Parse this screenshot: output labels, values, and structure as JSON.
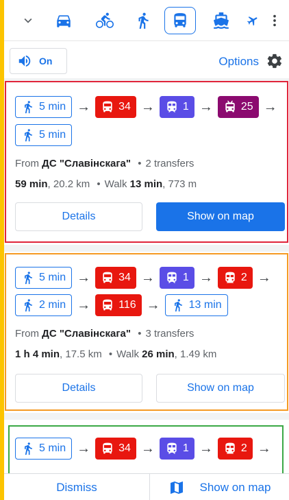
{
  "colors": {
    "frame": "#fcc400",
    "accent": "#1a73e8",
    "bus": "#e8170f",
    "metro": "#5a4de6",
    "trolleybus": "#8b0a6f",
    "tram": "#e8170f",
    "outline_1": "#e0243a",
    "outline_2": "#f59a23",
    "outline_3": "#3aa845"
  },
  "modes": [
    {
      "name": "car",
      "icon": "car-icon"
    },
    {
      "name": "bicycle",
      "icon": "bicycle-icon"
    },
    {
      "name": "walking",
      "icon": "walking-icon"
    },
    {
      "name": "transit",
      "icon": "bus-icon",
      "selected": true
    },
    {
      "name": "ferry",
      "icon": "ferry-icon"
    },
    {
      "name": "flight",
      "icon": "plane-icon"
    }
  ],
  "sound": {
    "label": "On",
    "icon": "speaker-icon"
  },
  "options_label": "Options",
  "routes": [
    {
      "steps_row1": [
        {
          "type": "walk",
          "label": "5 min"
        },
        {
          "type": "bus",
          "label": "34"
        },
        {
          "type": "metro",
          "label": "1"
        },
        {
          "type": "trolleybus",
          "label": "25"
        }
      ],
      "steps_row2": [
        {
          "type": "walk",
          "label": "5 min"
        }
      ],
      "from_prefix": "From ",
      "from_stop": "ДС \"Славінскага\"",
      "transfers": "2 transfers",
      "duration": "59 min",
      "distance": ", 20.2 km",
      "walk_prefix": "Walk ",
      "walk_time": "13 min",
      "walk_distance": ", 773 m",
      "details_label": "Details",
      "map_label": "Show on map"
    },
    {
      "steps_row1": [
        {
          "type": "walk",
          "label": "5 min"
        },
        {
          "type": "bus",
          "label": "34"
        },
        {
          "type": "metro",
          "label": "1"
        },
        {
          "type": "tram",
          "label": "2"
        }
      ],
      "steps_row2": [
        {
          "type": "walk",
          "label": "2 min"
        },
        {
          "type": "bus",
          "label": "116"
        },
        {
          "type": "walk",
          "label": "13 min"
        }
      ],
      "from_prefix": "From ",
      "from_stop": "ДС \"Славінскага\"",
      "transfers": "3 transfers",
      "duration": "1 h 4 min",
      "distance": ", 17.5 km",
      "walk_prefix": "Walk ",
      "walk_time": "26 min",
      "walk_distance": ", 1.49 km",
      "details_label": "Details",
      "map_label": "Show on map"
    },
    {
      "steps_row1": [
        {
          "type": "walk",
          "label": "5 min"
        },
        {
          "type": "bus",
          "label": "34"
        },
        {
          "type": "metro",
          "label": "1"
        },
        {
          "type": "tram",
          "label": "2"
        }
      ]
    }
  ],
  "bottom": {
    "dismiss_label": "Dismiss",
    "map_label": "Show on map",
    "map_icon": "map-icon"
  }
}
